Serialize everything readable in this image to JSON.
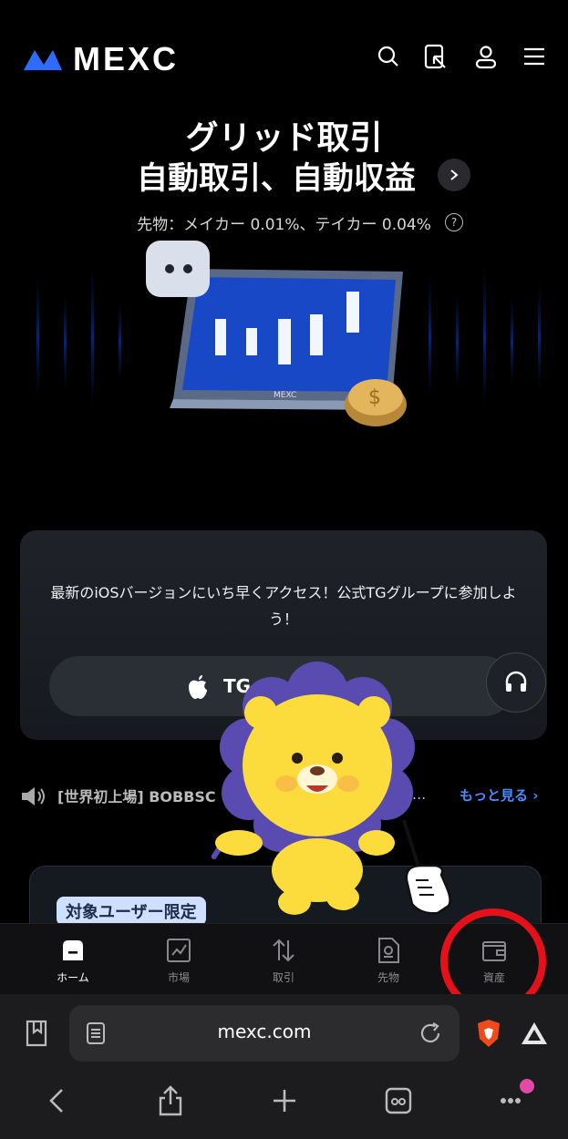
{
  "header": {
    "brand": "MEXC",
    "icons": [
      "search-icon",
      "scan-icon",
      "user-icon",
      "menu-icon"
    ]
  },
  "hero": {
    "line1": "グリッド取引",
    "line2": "自動取引、自動収益",
    "fees": "先物：メイカー 0.01%、テイカー 0.04%",
    "illustration_brand": "MEXC"
  },
  "promo": {
    "text": "最新のiOSバージョンにいち早くアクセス！公式TGグループに参加しよう！",
    "button_label": "TG"
  },
  "announcement": {
    "text": "[世界初上場] BOBBSC",
    "ellipsis": "...",
    "more": "もっと見る"
  },
  "lower_card": {
    "badge": "対象ユーザー限定"
  },
  "bottom_nav": {
    "items": [
      {
        "label": "ホーム",
        "icon": "home-icon",
        "active": true
      },
      {
        "label": "市場",
        "icon": "chart-icon",
        "active": false
      },
      {
        "label": "取引",
        "icon": "trade-arrows-icon",
        "active": false
      },
      {
        "label": "先物",
        "icon": "futures-doc-icon",
        "active": false
      },
      {
        "label": "資産",
        "icon": "wallet-icon",
        "active": false
      }
    ]
  },
  "browser": {
    "url": "mexc.com"
  },
  "colors": {
    "accent_blue": "#2f6bff",
    "link_blue": "#4a8cff",
    "highlight_red": "#e4101a"
  }
}
